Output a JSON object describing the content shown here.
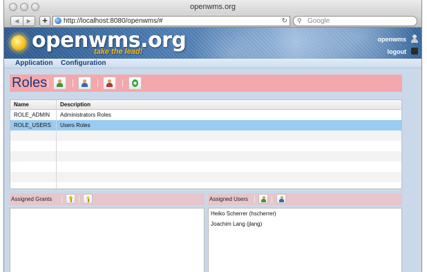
{
  "browser": {
    "window_title": "openwms.org",
    "back_arrow": "◀",
    "forward_arrow": "▶",
    "new_tab": "+",
    "url": "http://localhost:8080/openwms/#",
    "reload_icon": "↻",
    "search_placeholder": "Google",
    "search_icon": "⚲"
  },
  "header": {
    "logo": "openwms.org",
    "tagline": "take the lead!",
    "username": "openwms",
    "logout": "logout"
  },
  "menu": {
    "items": [
      "Application",
      "Configuration"
    ]
  },
  "roles": {
    "title": "Roles",
    "toolbar": [
      "add-role-icon",
      "edit-role-icon",
      "delete-role-icon",
      "refresh-icon"
    ],
    "columns": [
      "Name",
      "Description"
    ],
    "rows": [
      {
        "name": "ROLE_ADMIN",
        "description": "Administrators Roles",
        "selected": false
      },
      {
        "name": "ROLE_USERS",
        "description": "Users Roles",
        "selected": true
      }
    ]
  },
  "grants_panel": {
    "title": "Assigned Grants",
    "buttons": [
      "add-grant-icon",
      "remove-grant-icon"
    ]
  },
  "users_panel": {
    "title": "Assigned Users",
    "buttons": [
      "add-user-icon",
      "remove-user-icon"
    ],
    "users": [
      "Heiko Scherrer (hscherrer)",
      "Joachim Lang (jlang)"
    ]
  }
}
